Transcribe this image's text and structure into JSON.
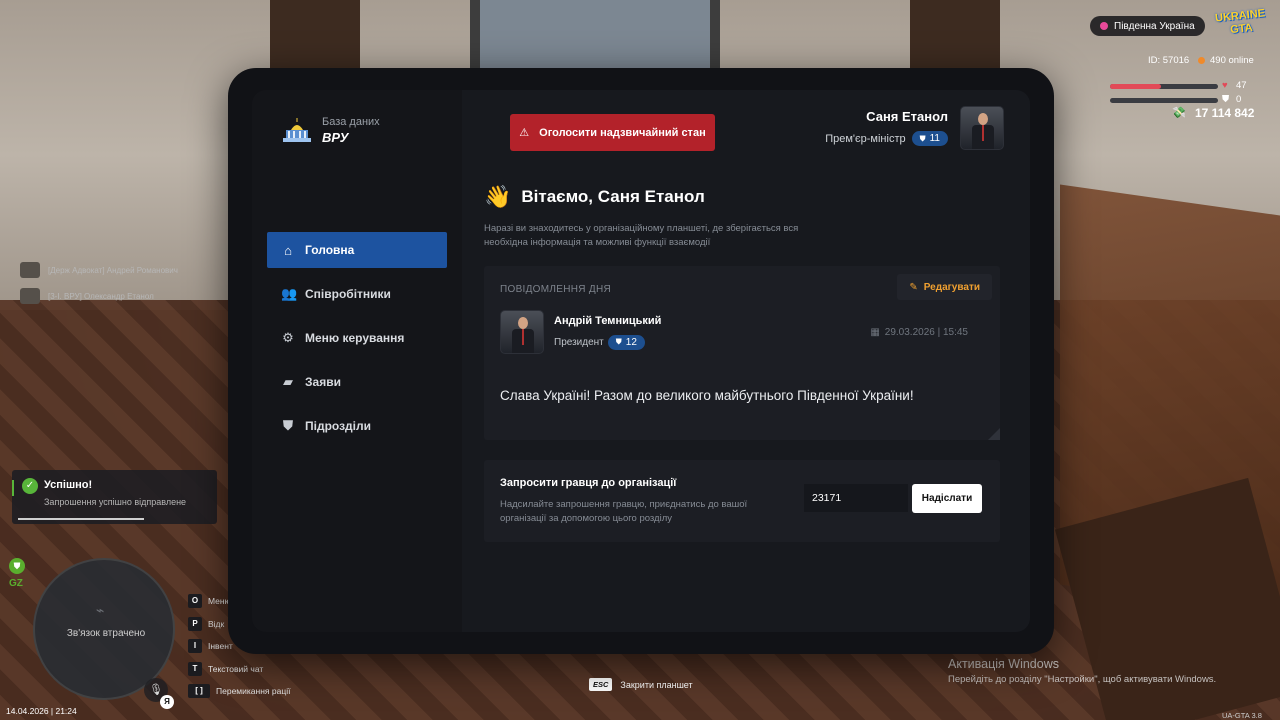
{
  "hud": {
    "server_name": "Південна Україна",
    "logo_text": "UKRAINE GTA",
    "player_id": "ID: 57016",
    "online": "490 online",
    "health": 47,
    "armor": 0,
    "money": "17 114 842",
    "datetime": "14.04.2026 | 21:24",
    "version": "UA-GTA 3.8",
    "gz_label": "GZ",
    "minimap_status": "Зв'язок втрачено",
    "mic_badge": "Я"
  },
  "chat": [
    {
      "text": "[Держ Адвокат] Андрей Романович"
    },
    {
      "text": "[3-І. ВРУ] Олександр Етанол"
    }
  ],
  "toast": {
    "title": "Успішно!",
    "message": "Запрошення успішно відправлене"
  },
  "keybinds": [
    {
      "key": "O",
      "label": "Меню"
    },
    {
      "key": "P",
      "label": "Відк"
    },
    {
      "key": "I",
      "label": "Інвент"
    },
    {
      "key": "T",
      "label": "Текстовий чат"
    },
    {
      "key": "[ ]",
      "label": "Перемикання рації"
    }
  ],
  "esc_hint": {
    "key": "ESC",
    "label": "Закрити планшет"
  },
  "windows_activation": {
    "title": "Активація Windows",
    "subtitle": "Перейдіть до розділу \"Настройки\", щоб активувати Windows."
  },
  "tablet": {
    "brand_sub": "База даних",
    "brand_title": "ВРУ",
    "emergency_button": "Оголосити надзвичайний стан",
    "user": {
      "name": "Саня Етанол",
      "role": "Прем'єр-міністр",
      "rank": "11"
    },
    "nav": [
      {
        "label": "Головна",
        "icon": "home-icon"
      },
      {
        "label": "Співробітники",
        "icon": "users-icon"
      },
      {
        "label": "Меню керування",
        "icon": "gear-icon"
      },
      {
        "label": "Заяви",
        "icon": "folder-icon"
      },
      {
        "label": "Підрозділи",
        "icon": "shield-icon"
      }
    ],
    "welcome": {
      "title": "Вітаємо, Саня Етанол",
      "description": "Наразі ви знаходитесь у організаційному планшеті, де зберігається вся необхідна інформація та можливі функції взаємодії"
    },
    "motd": {
      "label": "ПОВІДОМЛЕННЯ ДНЯ",
      "edit_label": "Редагувати",
      "author_name": "Андрій Темницький",
      "author_role": "Президент",
      "author_rank": "12",
      "date": "29.03.2026 | 15:45",
      "text": "Слава Україні! Разом до великого майбутнього Південної України!"
    },
    "invite": {
      "title": "Запросити гравця до організації",
      "description": "Надсилайте запрошення гравцю, приєднатись до вашої організації за допомогою цього розділу",
      "input_value": "23171",
      "send_label": "Надіслати"
    }
  },
  "colors": {
    "accent_blue": "#1d53a0",
    "danger_red": "#b3222a",
    "edit_orange": "#f0a030",
    "success_green": "#58b53a"
  }
}
